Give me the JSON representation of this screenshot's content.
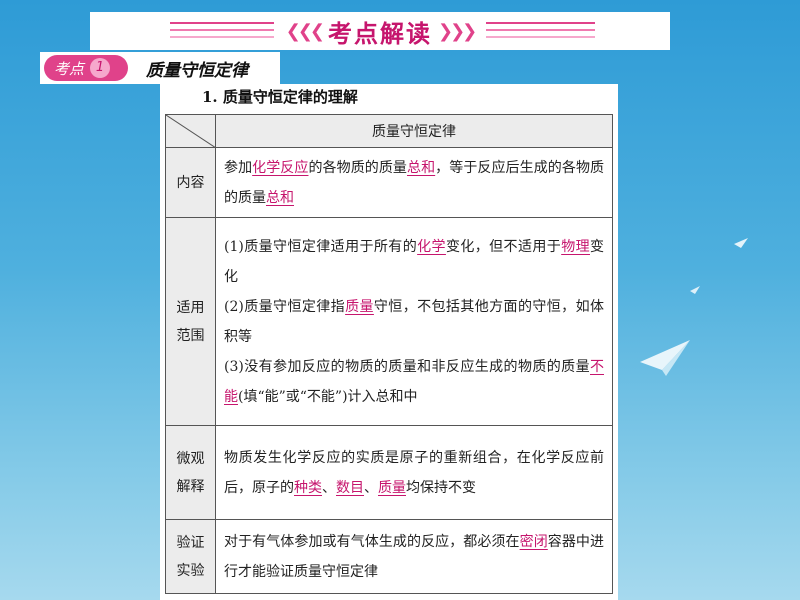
{
  "banner": {
    "title": "考点解读"
  },
  "section": {
    "badge_label": "考点",
    "badge_number": "1",
    "title": "质量守恒定律"
  },
  "subheading": "1. 质量守恒定律的理解",
  "table": {
    "header": "质量守恒定律",
    "rows": [
      {
        "label": "内容",
        "parts": [
          {
            "t": "参加"
          },
          {
            "t": "化学反应",
            "hl": true
          },
          {
            "t": "的各物质的质量"
          },
          {
            "t": "总和",
            "hl": true
          },
          {
            "t": "，等于反应后生成的各物质的质量"
          },
          {
            "t": "总和",
            "hl": true
          }
        ]
      },
      {
        "label": "适用范围",
        "parts": [
          {
            "t": "(1)质量守恒定律适用于所有的"
          },
          {
            "t": "化学",
            "hl": true
          },
          {
            "t": "变化，但不适用于"
          },
          {
            "t": "物理",
            "hl": true
          },
          {
            "t": "变化"
          },
          {
            "br": true
          },
          {
            "t": "(2)质量守恒定律指"
          },
          {
            "t": "质量",
            "hl": true
          },
          {
            "t": "守恒，不包括其他方面的守恒，如体积等"
          },
          {
            "br": true
          },
          {
            "t": "(3)没有参加反应的物质的质量和非反应生成的物质的质量"
          },
          {
            "t": "不能",
            "hl": true
          },
          {
            "t": "(填“能”或“不能”)计入总和中"
          }
        ]
      },
      {
        "label": "微观解释",
        "parts": [
          {
            "t": "物质发生化学反应的实质是原子的重新组合，在化学反应前后，原子的"
          },
          {
            "t": "种类",
            "hl": true
          },
          {
            "t": "、"
          },
          {
            "t": "数目",
            "hl": true
          },
          {
            "t": "、"
          },
          {
            "t": "质量",
            "hl": true
          },
          {
            "t": "均保持不变"
          }
        ]
      },
      {
        "label": "验证实验",
        "parts": [
          {
            "t": "对于有气体参加或有气体生成的反应，都必须在"
          },
          {
            "t": "密闭",
            "hl": true
          },
          {
            "t": "容器中进行才能验证质量守恒定律"
          }
        ]
      }
    ]
  },
  "colors": {
    "accent": "#e0428a",
    "highlight": "#c6156d",
    "bg_top": "#2e9bd6",
    "bg_bottom": "#a6d9ee",
    "cell_bg": "#ececec"
  }
}
